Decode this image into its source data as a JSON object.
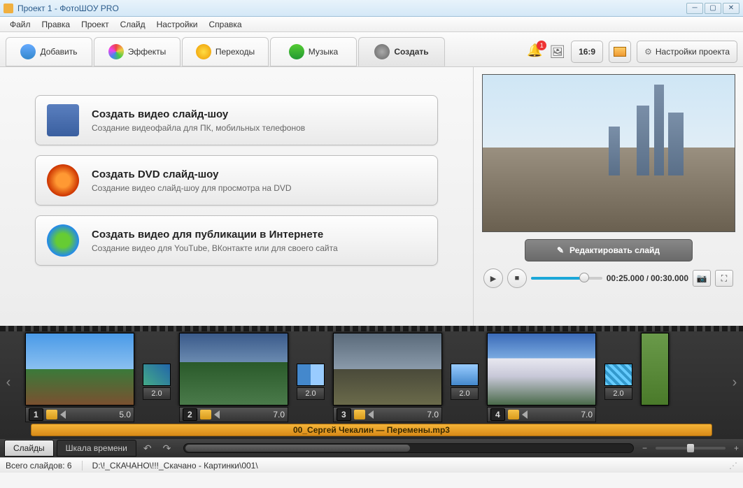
{
  "window": {
    "title": "Проект 1 - ФотоШОУ PRO"
  },
  "menu": {
    "file": "Файл",
    "edit": "Правка",
    "project": "Проект",
    "slide": "Слайд",
    "settings": "Настройки",
    "help": "Справка"
  },
  "tabs": {
    "add": "Добавить",
    "effects": "Эффекты",
    "transitions": "Переходы",
    "music": "Музыка",
    "create": "Создать"
  },
  "toolbar": {
    "notifications_count": "1",
    "aspect": "16:9",
    "project_settings": "Настройки проекта"
  },
  "create_options": [
    {
      "title": "Создать видео слайд-шоу",
      "desc": "Создание видеофайла для ПК, мобильных телефонов"
    },
    {
      "title": "Создать DVD слайд-шоу",
      "desc": "Создание видео слайд-шоу для просмотра на DVD"
    },
    {
      "title": "Создать видео для публикации в Интернете",
      "desc": "Создание видео для YouTube, ВКонтакте или для своего сайта"
    }
  ],
  "preview": {
    "edit_slide": "Редактировать слайд",
    "current_time": "00:25.000",
    "total_time": "00:30.000"
  },
  "timeline": {
    "slides": [
      {
        "num": "1",
        "duration": "5.0"
      },
      {
        "num": "2",
        "duration": "7.0"
      },
      {
        "num": "3",
        "duration": "7.0"
      },
      {
        "num": "4",
        "duration": "7.0"
      }
    ],
    "transitions": [
      {
        "duration": "2.0"
      },
      {
        "duration": "2.0"
      },
      {
        "duration": "2.0"
      },
      {
        "duration": "2.0"
      }
    ],
    "audio_track": "00_Сергей Чекалин — Перемены.mp3"
  },
  "view_tabs": {
    "slides": "Слайды",
    "timeline": "Шкала времени"
  },
  "status": {
    "total_slides_label": "Всего слайдов:",
    "total_slides_value": "6",
    "path": "D:\\!_СКАЧАНО\\!!!_Скачано - Картинки\\001\\"
  }
}
